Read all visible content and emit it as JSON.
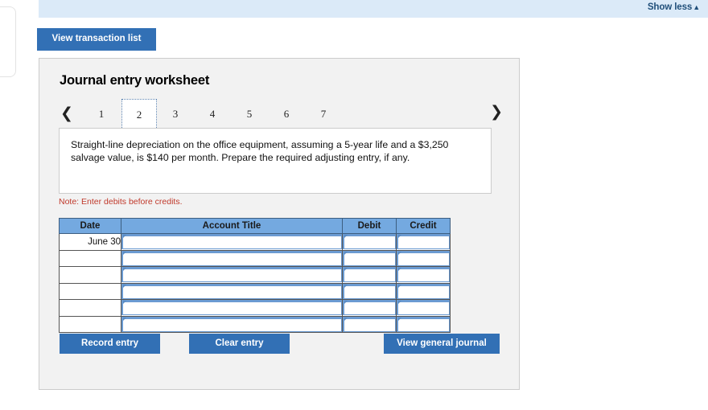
{
  "banner": {
    "show_less_label": "Show less",
    "caret_icon": "triangle-up-icon",
    "background": "#dbeaf8",
    "text_color": "#1f4e79"
  },
  "toolbar": {
    "view_transaction_list_label": "View transaction list"
  },
  "worksheet": {
    "title": "Journal entry worksheet",
    "prev_icon": "chevron-left-icon",
    "next_icon": "chevron-right-icon",
    "tabs": [
      {
        "label": "1",
        "active": false
      },
      {
        "label": "2",
        "active": true
      },
      {
        "label": "3",
        "active": false
      },
      {
        "label": "4",
        "active": false
      },
      {
        "label": "5",
        "active": false
      },
      {
        "label": "6",
        "active": false
      },
      {
        "label": "7",
        "active": false
      }
    ],
    "instruction": "Straight-line depreciation on the office equipment, assuming a 5-year life and a $3,250 salvage value, is $140 per month. Prepare the required adjusting entry, if any.",
    "note": "Note: Enter debits before credits."
  },
  "journal_table": {
    "columns": [
      "Date",
      "Account Title",
      "Debit",
      "Credit"
    ],
    "rows": [
      {
        "date": "June 30",
        "account_title": "",
        "debit": "",
        "credit": ""
      },
      {
        "date": "",
        "account_title": "",
        "debit": "",
        "credit": ""
      },
      {
        "date": "",
        "account_title": "",
        "debit": "",
        "credit": ""
      },
      {
        "date": "",
        "account_title": "",
        "debit": "",
        "credit": ""
      },
      {
        "date": "",
        "account_title": "",
        "debit": "",
        "credit": ""
      },
      {
        "date": "",
        "account_title": "",
        "debit": "",
        "credit": ""
      }
    ],
    "header_background": "#74a9e0"
  },
  "actions": {
    "record_entry_label": "Record entry",
    "clear_entry_label": "Clear entry",
    "view_general_journal_label": "View general journal",
    "button_color": "#3270b5"
  }
}
